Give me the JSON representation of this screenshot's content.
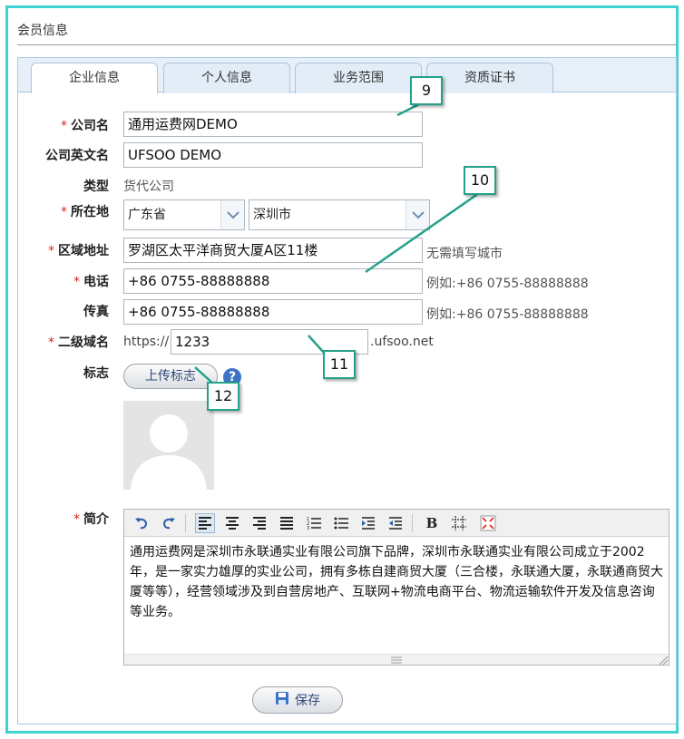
{
  "section": {
    "title": "会员信息"
  },
  "tabs": [
    {
      "label": "企业信息",
      "active": true
    },
    {
      "label": "个人信息",
      "active": false
    },
    {
      "label": "业务范围",
      "active": false
    },
    {
      "label": "资质证书",
      "active": false
    }
  ],
  "form": {
    "required_mark": "*",
    "company_name": {
      "label": "公司名",
      "value": "通用运费网DEMO"
    },
    "company_en_name": {
      "label": "公司英文名",
      "value": "UFSOO DEMO"
    },
    "type": {
      "label": "类型",
      "value": "货代公司"
    },
    "location": {
      "label": "所在地",
      "province": "广东省",
      "city": "深圳市"
    },
    "address": {
      "label": "区域地址",
      "value": "罗湖区太平洋商贸大厦A区11楼",
      "hint": "无需填写城市"
    },
    "phone": {
      "label": "电话",
      "value": "+86 0755-88888888",
      "hint": "例如:+86 0755-88888888"
    },
    "fax": {
      "label": "传真",
      "value": "+86 0755-88888888",
      "hint": "例如:+86 0755-88888888"
    },
    "subdomain": {
      "label": "二级域名",
      "prefix": "https://",
      "value": "1233",
      "suffix": ".ufsoo.net"
    },
    "logo": {
      "label": "标志",
      "upload_label": "上传标志",
      "help_icon": "question-icon"
    },
    "intro": {
      "label": "简介",
      "text": "通用运费网是深圳市永联通实业有限公司旗下品牌，深圳市永联通实业有限公司成立于2002年，是一家实力雄厚的实业公司，拥有多栋自建商贸大厦（三合楼，永联通大厦，永联通商贸大厦等等），经营领域涉及到自营房地产、互联网+物流电商平台、物流运输软件开发及信息咨询等业务。",
      "toolbar": [
        "undo-icon",
        "redo-icon",
        "align-left-icon",
        "align-center-icon",
        "align-right-icon",
        "align-justify-icon",
        "ordered-list-icon",
        "unordered-list-icon",
        "indent-icon",
        "outdent-icon",
        "bold-icon",
        "table-icon",
        "fullscreen-icon"
      ]
    },
    "save_label": "保存"
  },
  "callouts": [
    "9",
    "10",
    "11",
    "12"
  ],
  "colors": {
    "frame": "#3ed3d0",
    "callout_border": "#24a189",
    "required": "#d9261c",
    "tab_bar": "#e7eff8"
  }
}
